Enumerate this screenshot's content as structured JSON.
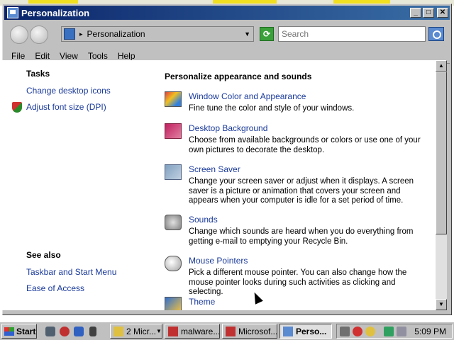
{
  "window": {
    "title": "Personalization"
  },
  "titlebar_buttons": {
    "minimize": "_",
    "maximize": "□",
    "close": "✕"
  },
  "address": {
    "breadcrumb_arrow": "▸",
    "path_text": "Personalization",
    "dropdown_arrow": "▼"
  },
  "refresh": {
    "glyph": "⟳"
  },
  "search": {
    "placeholder": "Search"
  },
  "menu": {
    "items": [
      "File",
      "Edit",
      "View",
      "Tools",
      "Help"
    ]
  },
  "sidebar": {
    "tasks_heading": "Tasks",
    "tasks": [
      "Change desktop icons",
      "Adjust font size (DPI)"
    ],
    "see_also_heading": "See also",
    "see_also": [
      "Taskbar and Start Menu",
      "Ease of Access"
    ]
  },
  "main": {
    "title": "Personalize appearance and sounds",
    "items": [
      {
        "icon": "color-palette-icon",
        "link": "Window Color and Appearance",
        "desc": "Fine tune the color and style of your windows."
      },
      {
        "icon": "desktop-background-icon",
        "link": "Desktop Background",
        "desc": "Choose from available backgrounds or colors or use one of your own pictures to decorate the desktop."
      },
      {
        "icon": "screen-saver-icon",
        "link": "Screen Saver",
        "desc": "Change your screen saver or adjust when it displays. A screen saver is a picture or animation that covers your screen and appears when your computer is idle for a set period of time."
      },
      {
        "icon": "sounds-icon",
        "link": "Sounds",
        "desc": "Change which sounds are heard when you do everything from getting e-mail to emptying your Recycle Bin."
      },
      {
        "icon": "mouse-pointer-icon",
        "link": "Mouse Pointers",
        "desc": "Pick a different mouse pointer. You can also change how the mouse pointer looks during such activities as clicking and selecting."
      },
      {
        "icon": "theme-icon",
        "link": "Theme",
        "desc": ""
      }
    ]
  },
  "scrollbar": {
    "up": "▲",
    "down": "▼"
  },
  "taskbar": {
    "start_label": "Start",
    "buttons": [
      {
        "label": "2 Micr...",
        "arrow": "▼"
      },
      {
        "label": "malware...",
        "arrow": ""
      },
      {
        "label": "Microsof...",
        "arrow": "▼"
      },
      {
        "label": "Perso...",
        "arrow": ""
      }
    ],
    "clock": "5:09 PM"
  },
  "colors": {
    "titlebar": "#0a246a",
    "link": "#1a3a9a",
    "chrome": "#c0c0c0"
  }
}
